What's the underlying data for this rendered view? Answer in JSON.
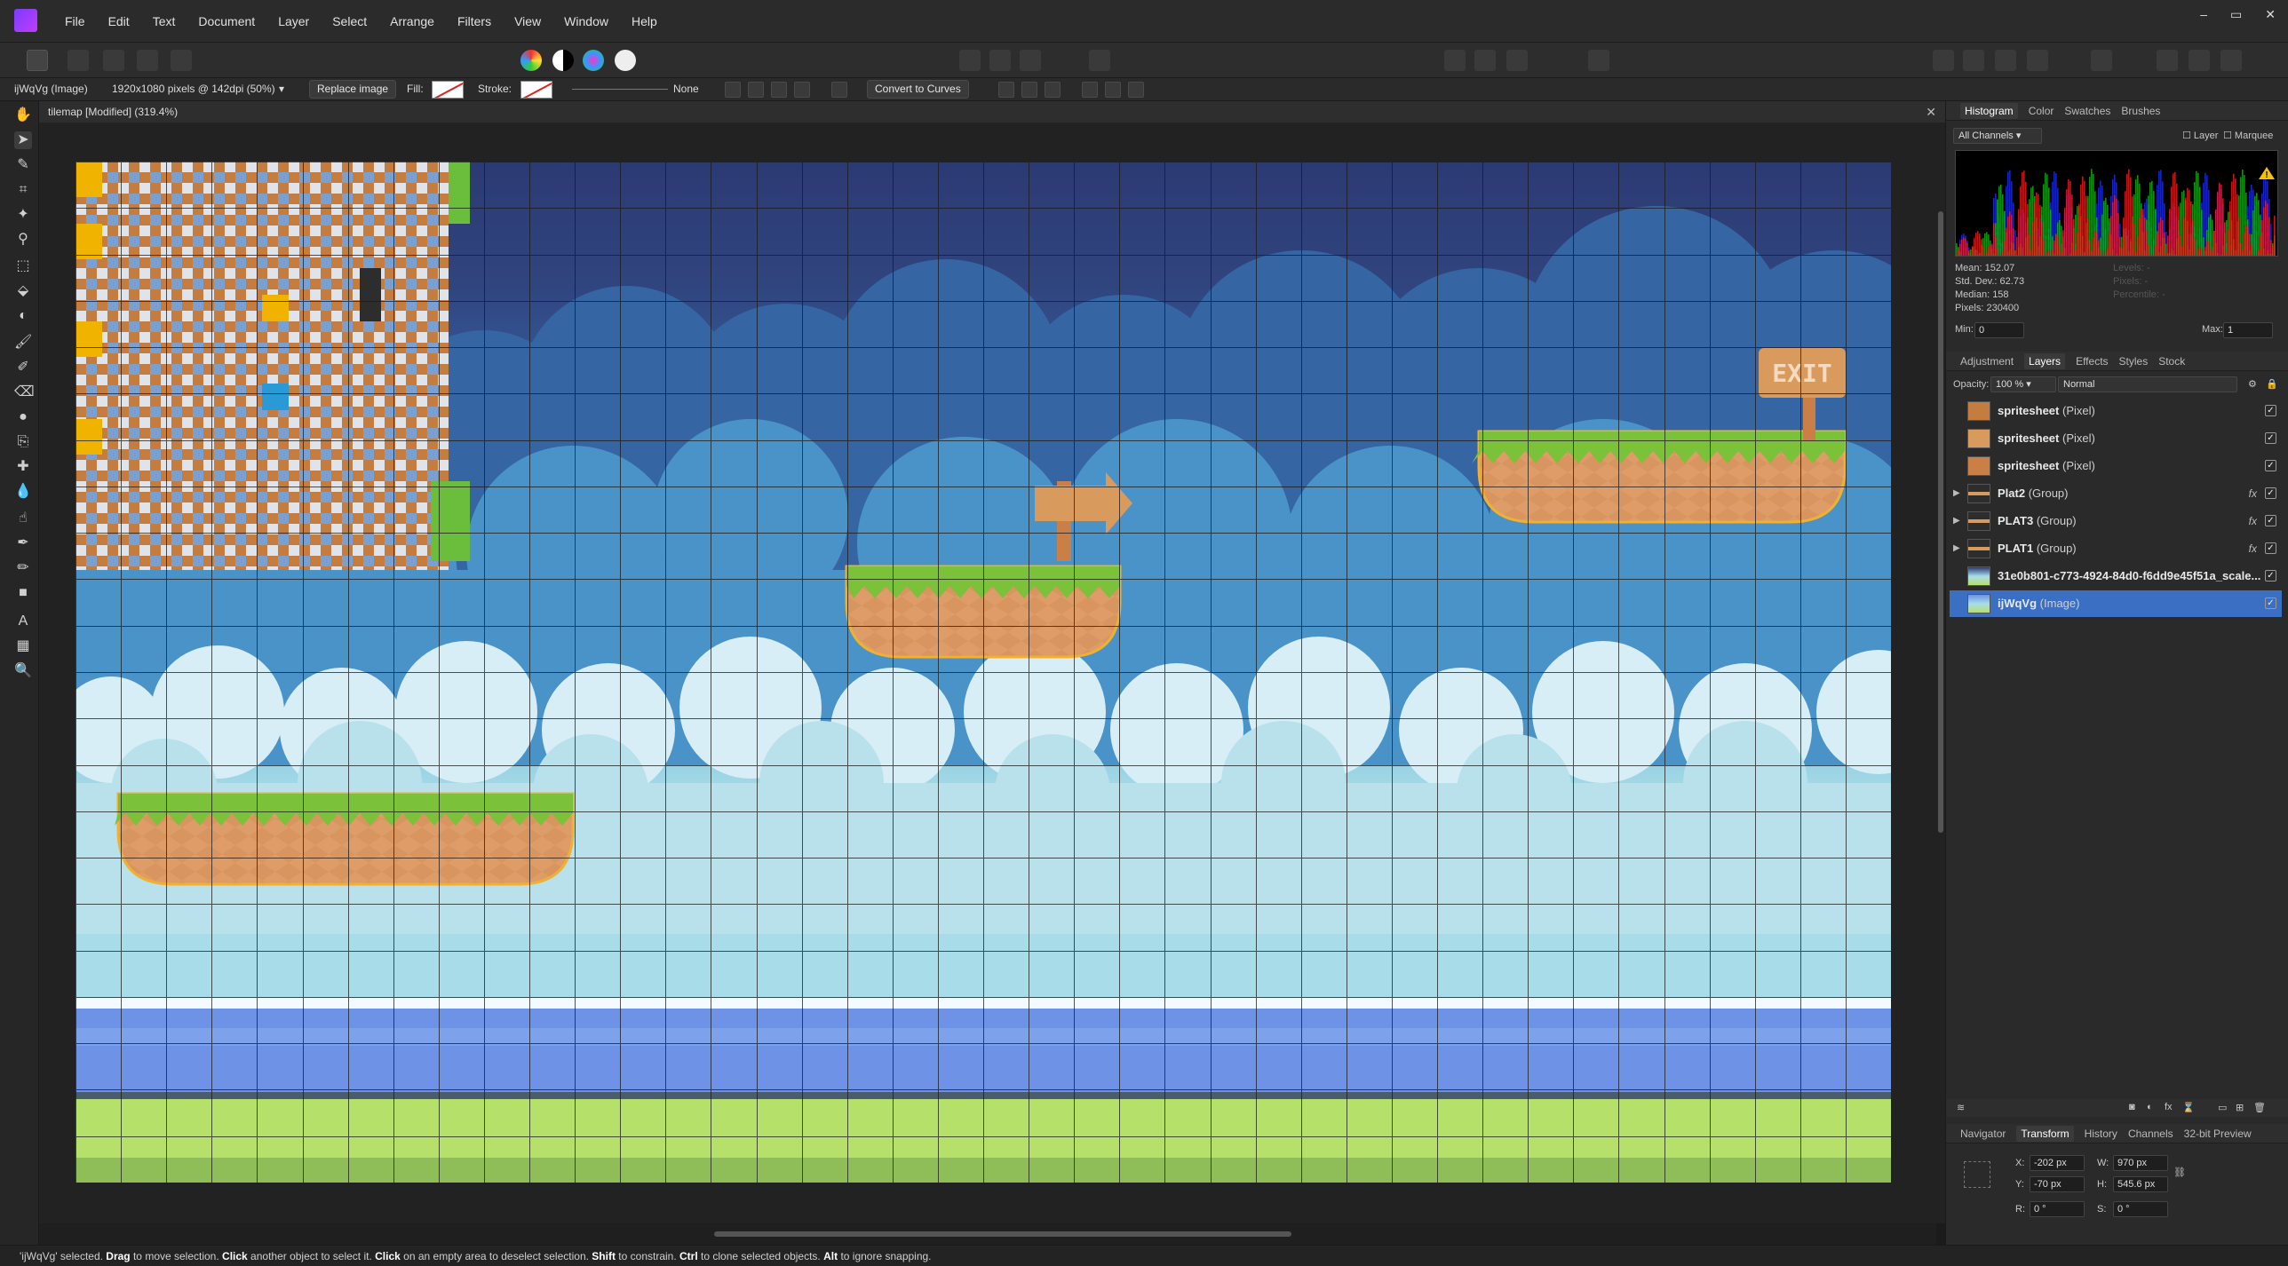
{
  "menubar": {
    "items": [
      "File",
      "Edit",
      "Text",
      "Document",
      "Layer",
      "Select",
      "Arrange",
      "Filters",
      "View",
      "Window",
      "Help"
    ],
    "window_controls": [
      "–",
      "▭",
      "✕"
    ]
  },
  "context": {
    "layer_name": "ijWqVg (Image)",
    "image_info": "1920x1080 pixels @ 142dpi (50%)",
    "replace_image": "Replace image",
    "fill_label": "Fill:",
    "stroke_label": "Stroke:",
    "stroke_style": "None",
    "convert_to_curves": "Convert to Curves"
  },
  "document": {
    "tab_title": "tilemap [Modified] (319.4%)",
    "close": "✕"
  },
  "canvas": {
    "exit_sign": "EXIT",
    "grid_cols": 40,
    "grid_rows": 22
  },
  "histogram_panel": {
    "tabs": [
      "Histogram",
      "Color",
      "Swatches",
      "Brushes"
    ],
    "active_tab": "Histogram",
    "channel": "All Channels",
    "layer_label": "Layer",
    "marquee_label": "Marquee",
    "mean": "Mean: 152.07",
    "std_dev": "Std. Dev.: 62.73",
    "median": "Median: 158",
    "pixels": "Pixels: 230400",
    "levels": "Levels: -",
    "count": "Pixels: -",
    "percentile": "Percentile: -",
    "min_label": "Min:",
    "min_value": "0",
    "max_label": "Max:",
    "max_value": "1",
    "warning": "!"
  },
  "layers_panel": {
    "tabs": [
      "Adjustment",
      "Layers",
      "Effects",
      "Styles",
      "Stock"
    ],
    "active_tab": "Layers",
    "opacity_label": "Opacity:",
    "opacity_value": "100 %",
    "blend_mode": "Normal",
    "layers": [
      {
        "name": "spritesheet",
        "type": "(Pixel)",
        "group": false,
        "fx": false,
        "selected": false
      },
      {
        "name": "spritesheet",
        "type": "(Pixel)",
        "group": false,
        "fx": false,
        "selected": false
      },
      {
        "name": "spritesheet",
        "type": "(Pixel)",
        "group": false,
        "fx": false,
        "selected": false
      },
      {
        "name": "Plat2",
        "type": "(Group)",
        "group": true,
        "fx": true,
        "selected": false
      },
      {
        "name": "PLAT3",
        "type": "(Group)",
        "group": true,
        "fx": true,
        "selected": false
      },
      {
        "name": "PLAT1",
        "type": "(Group)",
        "group": true,
        "fx": true,
        "selected": false
      },
      {
        "name": "31e0b801-c773-4924-84d0-f6dd9e45f51a_scale...",
        "type": "",
        "group": false,
        "fx": false,
        "selected": false
      },
      {
        "name": "ijWqVg",
        "type": "(Image)",
        "group": false,
        "fx": false,
        "selected": true
      }
    ]
  },
  "transform_panel": {
    "tabs": [
      "Navigator",
      "Transform",
      "History",
      "Channels",
      "32-bit Preview"
    ],
    "active_tab": "Transform",
    "x_label": "X:",
    "x_value": "-202 px",
    "y_label": "Y:",
    "y_value": "-70 px",
    "w_label": "W:",
    "w_value": "970 px",
    "h_label": "H:",
    "h_value": "545.6 px",
    "r_label": "R:",
    "r_value": "0 °",
    "s_label": "S:",
    "s_value": "0 °"
  },
  "statusbar": {
    "p1": "'ijWqVg' selected. ",
    "b1": "Drag",
    "p2": " to move selection. ",
    "b2": "Click",
    "p3": " another object to select it. ",
    "b3": "Click",
    "p4": " on an empty area to deselect selection. ",
    "b4": "Shift",
    "p5": " to constrain. ",
    "b5": "Ctrl",
    "p6": " to clone selected objects. ",
    "b6": "Alt",
    "p7": " to ignore snapping."
  },
  "colors": {
    "sky_top": "#2c3a73",
    "sky_mid": "#3f79b8",
    "cloud_light": "#d8eef7",
    "sky_low": "#a8dce8",
    "water": "#6d92e6",
    "grass": "#b5e16a",
    "platform_grass": "#7cc13a",
    "platform_dirt": "#d9955f",
    "selection": "#3a6fc4"
  }
}
